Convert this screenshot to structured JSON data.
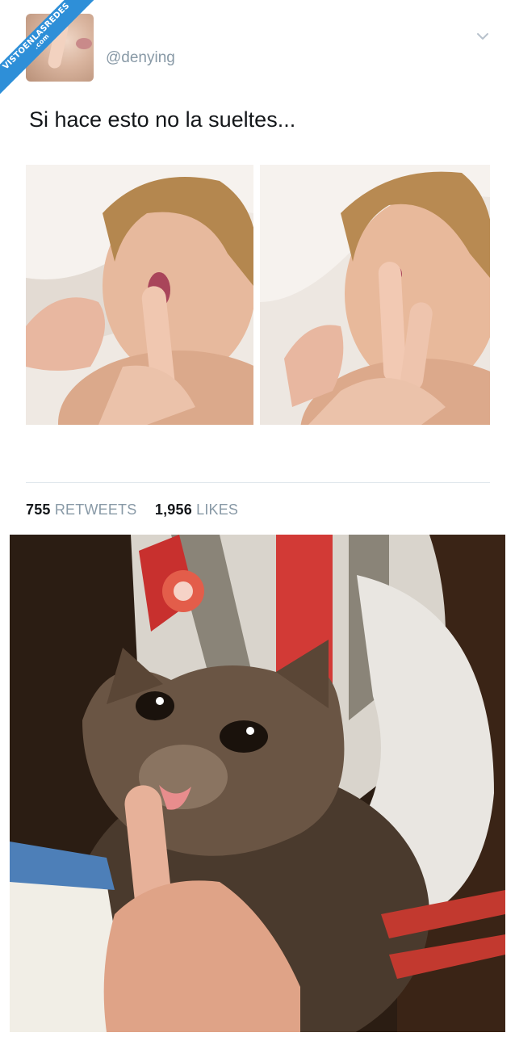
{
  "watermark": {
    "line1": "VISTOENLASREDES",
    "line2": ".com"
  },
  "tweet": {
    "handle": "@denying",
    "text": "Si hace esto no la sueltes...",
    "retweets_count": "755",
    "retweets_label": "RETWEETS",
    "likes_count": "1,956",
    "likes_label": "LIKES",
    "menu_icon": "chevron-down-icon"
  },
  "colors": {
    "text_primary": "#14171a",
    "text_secondary": "#8899a6",
    "ribbon": "#2e8fd8",
    "divider": "#e1e8ed"
  }
}
